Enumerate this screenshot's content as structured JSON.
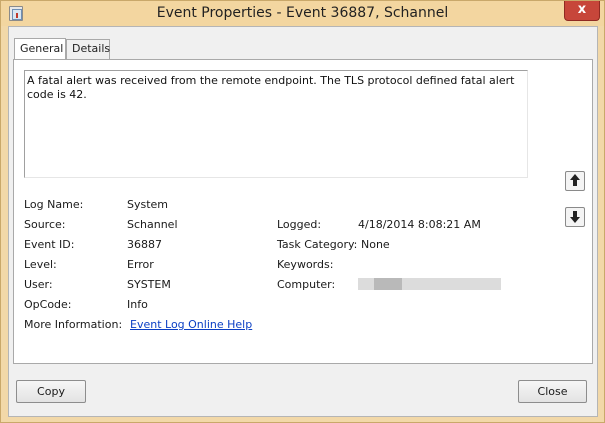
{
  "window": {
    "title": "Event Properties - Event 36887, Schannel",
    "close_glyph": "x"
  },
  "tabs": [
    {
      "label": "General",
      "active": true
    },
    {
      "label": "Details",
      "active": false
    }
  ],
  "general": {
    "description": "A fatal alert was received from the remote endpoint. The TLS protocol defined fatal alert code is 42.",
    "fields": {
      "log_name_label": "Log Name:",
      "log_name": "System",
      "source_label": "Source:",
      "source": "Schannel",
      "logged_label": "Logged:",
      "logged": "4/18/2014 8:08:21 AM",
      "event_id_label": "Event ID:",
      "event_id": "36887",
      "task_category_label": "Task Category:",
      "task_category": "None",
      "level_label": "Level:",
      "level": "Error",
      "keywords_label": "Keywords:",
      "user_label": "User:",
      "user": "SYSTEM",
      "computer_label": "Computer:",
      "opcode_label": "OpCode:",
      "opcode": "Info",
      "more_info_label": "More Information:",
      "more_info_link": "Event Log Online Help"
    }
  },
  "buttons": {
    "copy": "Copy",
    "close": "Close"
  },
  "icons": {
    "app": "event-viewer-icon",
    "previous": "arrow-up-icon",
    "next": "arrow-down-icon"
  },
  "colors": {
    "titlebar": "#f3d6a0",
    "close_button": "#c7463a",
    "link": "#0b3fc4"
  }
}
